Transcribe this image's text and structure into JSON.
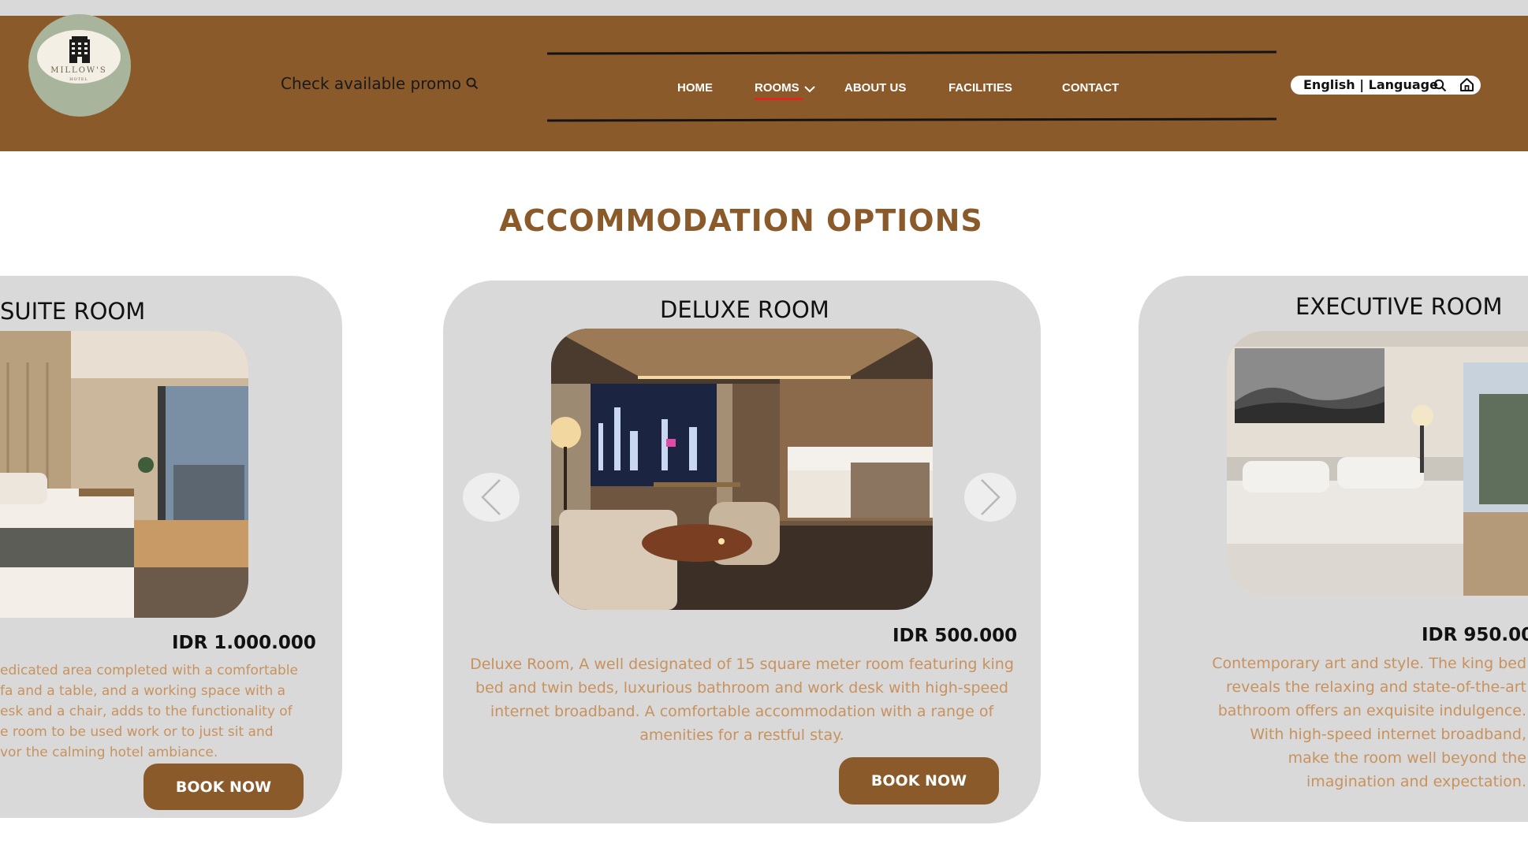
{
  "header": {
    "logo_text": "MILLOW'S",
    "logo_sub": "HOTEL",
    "promo_label": "Check available promo",
    "nav": [
      {
        "label": "HOME"
      },
      {
        "label": "ROOMS"
      },
      {
        "label": "ABOUT US"
      },
      {
        "label": "FACILITIES"
      },
      {
        "label": "CONTACT"
      }
    ],
    "active_nav": "ROOMS",
    "language_label": "English | Language"
  },
  "section": {
    "title": "ACCOMMODATION OPTIONS"
  },
  "rooms": [
    {
      "title": "SUITE ROOM",
      "price": "IDR 1.000.000",
      "desc_lines": [
        "edicated area completed with a comfortable",
        "fa and a table, and a working space with a",
        "esk and a chair, adds to the functionality of",
        "e room to be used work or to just sit and",
        "vor the calming hotel ambiance."
      ],
      "button": "BOOK NOW"
    },
    {
      "title": "DELUXE ROOM",
      "price": "IDR 500.000",
      "desc_lines": [
        "Deluxe Room, A well designated of 15 square meter room featuring king",
        "bed and twin beds, luxurious bathroom and work desk with high-speed",
        "internet broadband. A comfortable accommodation with a range of",
        "amenities for a restful stay."
      ],
      "button": "BOOK NOW"
    },
    {
      "title": "EXECUTIVE ROOM",
      "price": "IDR 950.00",
      "desc_lines": [
        "Contemporary art and style. The king bed",
        "reveals the relaxing and state-of-the-art",
        "bathroom offers an exquisite indulgence.",
        "With high-speed internet broadband,",
        "make the room well beyond the",
        "imagination and expectation."
      ],
      "button": ""
    }
  ],
  "colors": {
    "brand": "#8b5a2b",
    "accent_underline": "#e0261f",
    "card_bg": "#d9d9d9",
    "desc_text": "#c8925e"
  }
}
